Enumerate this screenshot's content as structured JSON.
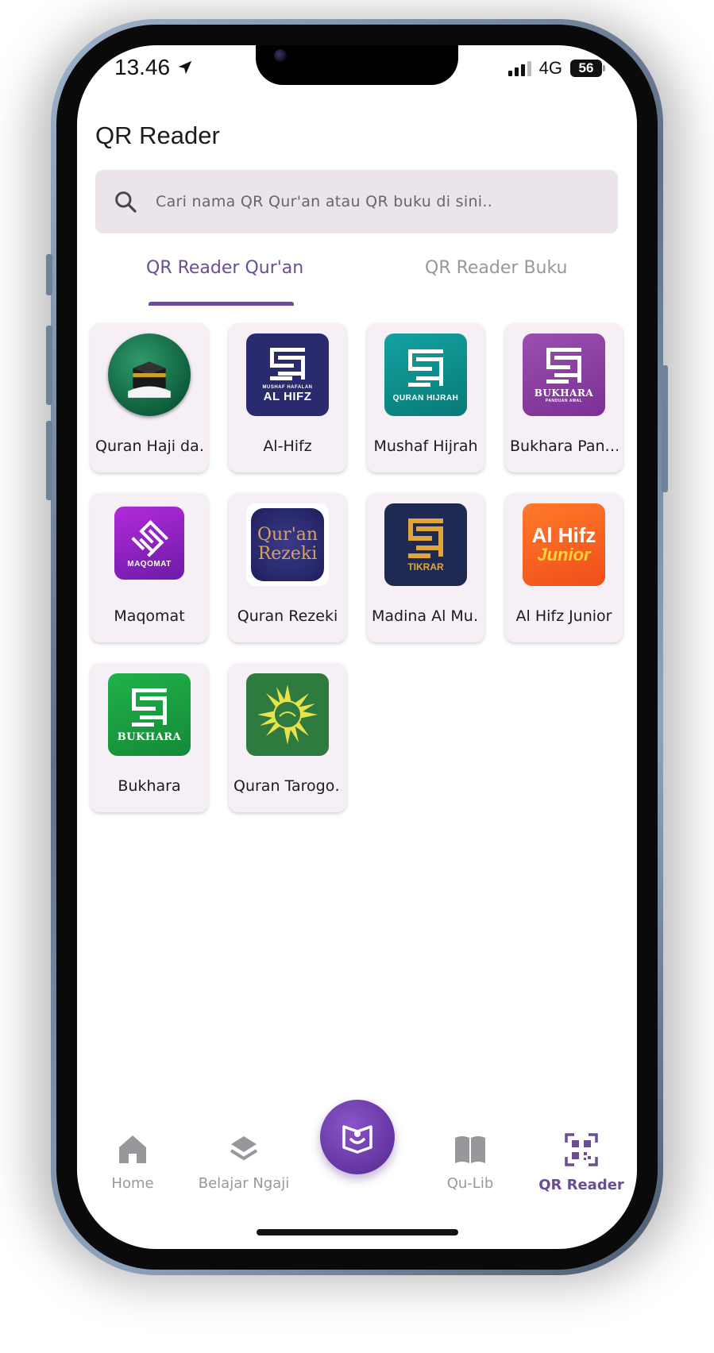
{
  "status_bar": {
    "time": "13.46",
    "network": "4G",
    "battery": "56"
  },
  "page": {
    "title": "QR Reader"
  },
  "search": {
    "placeholder": "Cari nama QR Qur'an atau QR buku di sini.."
  },
  "tabs": [
    {
      "label": "QR Reader Qur'an",
      "active": true
    },
    {
      "label": "QR Reader Buku",
      "active": false
    }
  ],
  "items": [
    {
      "label": "Quran Haji da…",
      "icon": "kaaba-icon"
    },
    {
      "label": "Al-Hifz",
      "icon": "al-hifz-icon",
      "icon_text": "AL HIFZ",
      "icon_subtext": "MUSHAF HAFALAN"
    },
    {
      "label": "Mushaf Hijrah",
      "icon": "quran-hijrah-icon",
      "icon_text": "QURAN HIJRAH"
    },
    {
      "label": "Bukhara Pan…",
      "icon": "bukhara-panduan-icon",
      "icon_text": "BUKHARA",
      "icon_subtext": "PANDUAN AMAL"
    },
    {
      "label": "Maqomat",
      "icon": "maqomat-icon",
      "icon_text": "MAQOMAT"
    },
    {
      "label": "Quran Rezeki",
      "icon": "quran-rezeki-icon",
      "icon_text": "Qur'an",
      "icon_subtext": "Rezeki"
    },
    {
      "label": "Madina Al Mu…",
      "icon": "tikrar-icon",
      "icon_text": "TIKRAR"
    },
    {
      "label": "Al Hifz Junior",
      "icon": "al-hifz-junior-icon",
      "icon_text": "Al Hifz",
      "icon_subtext": "Junior"
    },
    {
      "label": "Bukhara",
      "icon": "bukhara-icon",
      "icon_text": "BUKHARA"
    },
    {
      "label": "Quran Tarogo…",
      "icon": "muhammadiyah-emblem-icon"
    }
  ],
  "bottom_nav": [
    {
      "label": "Home",
      "icon": "home-icon",
      "active": false
    },
    {
      "label": "Belajar Ngaji",
      "icon": "layers-icon",
      "active": false
    },
    {
      "label": "Qu-Lib",
      "icon": "open-book-icon",
      "active": false
    },
    {
      "label": "QR Reader",
      "icon": "qr-code-icon",
      "active": true
    }
  ],
  "colors": {
    "accent": "#6a4d94",
    "card_bg": "#f6eff6",
    "search_bg": "#ebe4ea"
  }
}
